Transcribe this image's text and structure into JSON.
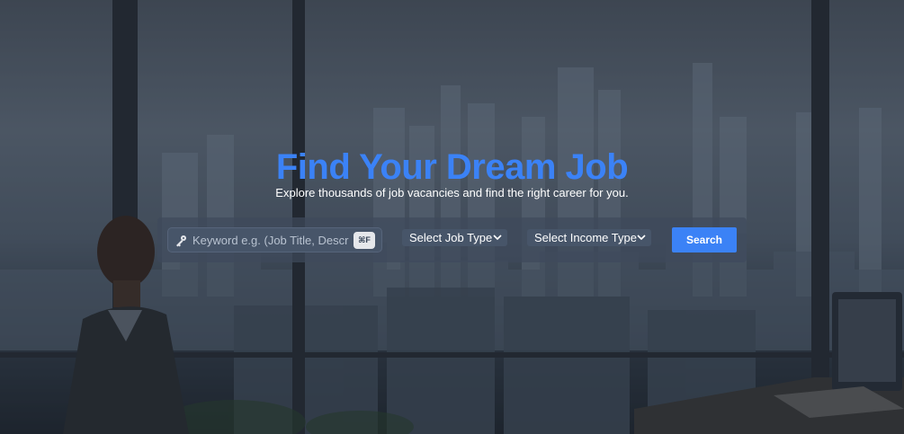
{
  "hero": {
    "title": "Find Your Dream Job",
    "subtitle": "Explore thousands of job vacancies and find the right career for you."
  },
  "search": {
    "keyword_placeholder": "Keyword e.g. (Job Title, Description, Tags)",
    "keyword_value": "",
    "shortcut": "⌘F",
    "job_type_label": "Select Job Type",
    "income_type_label": "Select Income Type",
    "button_label": "Search"
  },
  "icons": {
    "keyword": "key-icon",
    "dropdown": "chevron-down-icon"
  },
  "colors": {
    "accent": "#3b82f6",
    "bar": "#3e4a5c",
    "field": "#475569"
  }
}
